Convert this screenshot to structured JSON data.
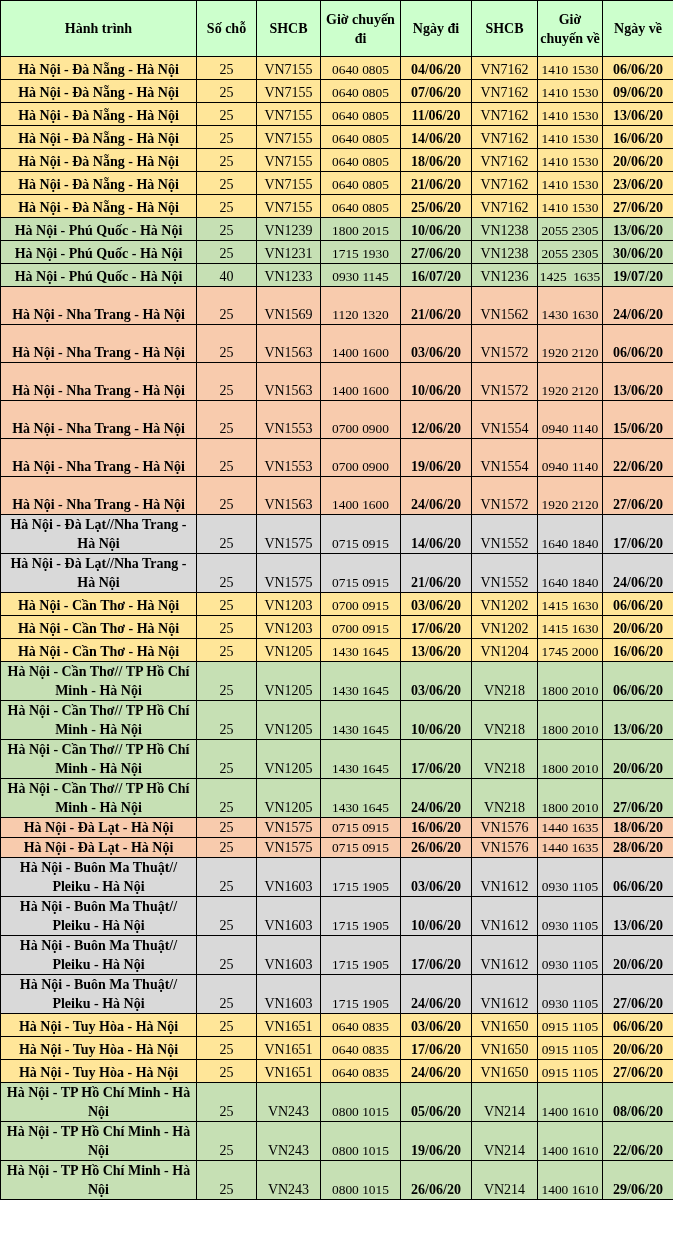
{
  "table": {
    "columns": [
      "Hành trình",
      "Số chỗ",
      "SHCB",
      "Giờ chuyến đi",
      "Ngày đi",
      "SHCB",
      "Giờ chuyến về",
      "Ngày về"
    ],
    "rows": [
      {
        "color": "#ffe699",
        "cells": [
          "Hà Nội - Đà Nẵng - Hà Nội",
          "25",
          "VN7155",
          "0640 0805",
          "04/06/20",
          "VN7162",
          "1410 1530",
          "06/06/20"
        ]
      },
      {
        "color": "#ffe699",
        "cells": [
          "Hà Nội - Đà Nẵng - Hà Nội",
          "25",
          "VN7155",
          "0640 0805",
          "07/06/20",
          "VN7162",
          "1410 1530",
          "09/06/20"
        ]
      },
      {
        "color": "#ffe699",
        "cells": [
          "Hà Nội - Đà Nẵng - Hà Nội",
          "25",
          "VN7155",
          "0640 0805",
          "11/06/20",
          "VN7162",
          "1410 1530",
          "13/06/20"
        ]
      },
      {
        "color": "#ffe699",
        "cells": [
          "Hà Nội - Đà Nẵng - Hà Nội",
          "25",
          "VN7155",
          "0640 0805",
          "14/06/20",
          "VN7162",
          "1410 1530",
          "16/06/20"
        ]
      },
      {
        "color": "#ffe699",
        "cells": [
          "Hà Nội - Đà Nẵng - Hà Nội",
          "25",
          "VN7155",
          "0640 0805",
          "18/06/20",
          "VN7162",
          "1410 1530",
          "20/06/20"
        ]
      },
      {
        "color": "#ffe699",
        "cells": [
          "Hà Nội - Đà Nẵng - Hà Nội",
          "25",
          "VN7155",
          "0640 0805",
          "21/06/20",
          "VN7162",
          "1410 1530",
          "23/06/20"
        ]
      },
      {
        "color": "#ffe699",
        "cells": [
          "Hà Nội - Đà Nẵng - Hà Nội",
          "25",
          "VN7155",
          "0640 0805",
          "25/06/20",
          "VN7162",
          "1410 1530",
          "27/06/20"
        ]
      },
      {
        "color": "#c6e0b4",
        "cells": [
          "Hà Nội - Phú Quốc - Hà Nội",
          "25",
          "VN1239",
          "1800 2015",
          "10/06/20",
          "VN1238",
          "2055 2305",
          "13/06/20"
        ]
      },
      {
        "color": "#c6e0b4",
        "cells": [
          "Hà Nội - Phú Quốc - Hà Nội",
          "25",
          "VN1231",
          "1715 1930",
          "27/06/20",
          "VN1238",
          "2055 2305",
          "30/06/20"
        ]
      },
      {
        "color": "#c6e0b4",
        "cells": [
          "Hà Nội - Phú Quốc - Hà Nội",
          "40",
          "VN1233",
          "0930 1145",
          "16/07/20",
          "VN1236",
          "1425  1635",
          "19/07/20"
        ]
      },
      {
        "color": "#f8cbad",
        "cells": [
          "Hà Nội - Nha Trang - Hà Nội",
          "25",
          "VN1569",
          "1120 1320",
          "21/06/20",
          "VN1562",
          "1430 1630",
          "24/06/20"
        ]
      },
      {
        "color": "#f8cbad",
        "cells": [
          "Hà Nội - Nha Trang - Hà Nội",
          "25",
          "VN1563",
          "1400 1600",
          "03/06/20",
          "VN1572",
          "1920 2120",
          "06/06/20"
        ]
      },
      {
        "color": "#f8cbad",
        "cells": [
          "Hà Nội - Nha Trang - Hà Nội",
          "25",
          "VN1563",
          "1400 1600",
          "10/06/20",
          "VN1572",
          "1920 2120",
          "13/06/20"
        ]
      },
      {
        "color": "#f8cbad",
        "cells": [
          "Hà Nội - Nha Trang - Hà Nội",
          "25",
          "VN1553",
          "0700 0900",
          "12/06/20",
          "VN1554",
          "0940 1140",
          "15/06/20"
        ]
      },
      {
        "color": "#f8cbad",
        "cells": [
          "Hà Nội - Nha Trang - Hà Nội",
          "25",
          "VN1553",
          "0700 0900",
          "19/06/20",
          "VN1554",
          "0940 1140",
          "22/06/20"
        ]
      },
      {
        "color": "#f8cbad",
        "cells": [
          "Hà Nội - Nha Trang - Hà Nội",
          "25",
          "VN1563",
          "1400 1600",
          "24/06/20",
          "VN1572",
          "1920 2120",
          "27/06/20"
        ]
      },
      {
        "color": "#d9d9d9",
        "cells": [
          "Hà Nội - Đà Lạt//Nha Trang - Hà Nội",
          "25",
          "VN1575",
          "0715 0915",
          "14/06/20",
          "VN1552",
          "1640 1840",
          "17/06/20"
        ]
      },
      {
        "color": "#d9d9d9",
        "cells": [
          "Hà Nội - Đà Lạt//Nha Trang - Hà Nội",
          "25",
          "VN1575",
          "0715 0915",
          "21/06/20",
          "VN1552",
          "1640 1840",
          "24/06/20"
        ]
      },
      {
        "color": "#ffe699",
        "cells": [
          "Hà Nội - Cần Thơ - Hà Nội",
          "25",
          "VN1203",
          "0700 0915",
          "03/06/20",
          "VN1202",
          "1415 1630",
          "06/06/20"
        ]
      },
      {
        "color": "#ffe699",
        "cells": [
          "Hà Nội - Cần Thơ - Hà Nội",
          "25",
          "VN1203",
          "0700 0915",
          "17/06/20",
          "VN1202",
          "1415 1630",
          "20/06/20"
        ]
      },
      {
        "color": "#ffe699",
        "cells": [
          "Hà Nội - Cần Thơ - Hà Nội",
          "25",
          "VN1205",
          "1430 1645",
          "13/06/20",
          "VN1204",
          "1745 2000",
          "16/06/20"
        ]
      },
      {
        "color": "#c6e0b4",
        "cells": [
          "Hà Nội - Cần Thơ// TP Hồ Chí Minh - Hà Nội",
          "25",
          "VN1205",
          "1430 1645",
          "03/06/20",
          "VN218",
          "1800 2010",
          "06/06/20"
        ]
      },
      {
        "color": "#c6e0b4",
        "cells": [
          "Hà Nội - Cần Thơ// TP Hồ Chí Minh - Hà Nội",
          "25",
          "VN1205",
          "1430 1645",
          "10/06/20",
          "VN218",
          "1800 2010",
          "13/06/20"
        ]
      },
      {
        "color": "#c6e0b4",
        "cells": [
          "Hà Nội - Cần Thơ// TP Hồ Chí Minh - Hà Nội",
          "25",
          "VN1205",
          "1430 1645",
          "17/06/20",
          "VN218",
          "1800 2010",
          "20/06/20"
        ]
      },
      {
        "color": "#c6e0b4",
        "cells": [
          "Hà Nội - Cần Thơ// TP Hồ Chí Minh - Hà Nội",
          "25",
          "VN1205",
          "1430 1645",
          "24/06/20",
          "VN218",
          "1800 2010",
          "27/06/20"
        ]
      },
      {
        "color": "#f8cbad",
        "cells": [
          "Hà Nội - Đà Lạt - Hà Nội",
          "25",
          "VN1575",
          "0715 0915",
          "16/06/20",
          "VN1576",
          "1440 1635",
          "18/06/20"
        ]
      },
      {
        "color": "#f8cbad",
        "cells": [
          "Hà Nội - Đà Lạt - Hà Nội",
          "25",
          "VN1575",
          "0715 0915",
          "26/06/20",
          "VN1576",
          "1440 1635",
          "28/06/20"
        ]
      },
      {
        "color": "#d9d9d9",
        "cells": [
          "Hà Nội - Buôn Ma Thuật// Pleiku - Hà Nội",
          "25",
          "VN1603",
          "1715 1905",
          "03/06/20",
          "VN1612",
          "0930 1105",
          "06/06/20"
        ]
      },
      {
        "color": "#d9d9d9",
        "cells": [
          "Hà Nội - Buôn Ma Thuật// Pleiku - Hà Nội",
          "25",
          "VN1603",
          "1715 1905",
          "10/06/20",
          "VN1612",
          "0930 1105",
          "13/06/20"
        ]
      },
      {
        "color": "#d9d9d9",
        "cells": [
          "Hà Nội - Buôn Ma Thuật// Pleiku - Hà Nội",
          "25",
          "VN1603",
          "1715 1905",
          "17/06/20",
          "VN1612",
          "0930 1105",
          "20/06/20"
        ]
      },
      {
        "color": "#d9d9d9",
        "cells": [
          "Hà Nội - Buôn Ma Thuật// Pleiku - Hà Nội",
          "25",
          "VN1603",
          "1715 1905",
          "24/06/20",
          "VN1612",
          "0930 1105",
          "27/06/20"
        ]
      },
      {
        "color": "#ffe699",
        "cells": [
          "Hà Nội - Tuy Hòa - Hà Nội",
          "25",
          "VN1651",
          "0640 0835",
          "03/06/20",
          "VN1650",
          "0915 1105",
          "06/06/20"
        ]
      },
      {
        "color": "#ffe699",
        "cells": [
          "Hà Nội - Tuy Hòa - Hà Nội",
          "25",
          "VN1651",
          "0640 0835",
          "17/06/20",
          "VN1650",
          "0915 1105",
          "20/06/20"
        ]
      },
      {
        "color": "#ffe699",
        "cells": [
          "Hà Nội - Tuy Hòa - Hà Nội",
          "25",
          "VN1651",
          "0640 0835",
          "24/06/20",
          "VN1650",
          "0915 1105",
          "27/06/20"
        ]
      },
      {
        "color": "#c6e0b4",
        "cells": [
          "Hà Nội - TP Hồ Chí Minh - Hà Nội",
          "25",
          "VN243",
          "0800 1015",
          "05/06/20",
          "VN214",
          "1400 1610",
          "08/06/20"
        ]
      },
      {
        "color": "#c6e0b4",
        "cells": [
          "Hà Nội - TP Hồ Chí Minh - Hà Nội",
          "25",
          "VN243",
          "0800 1015",
          "19/06/20",
          "VN214",
          "1400 1610",
          "22/06/20"
        ]
      },
      {
        "color": "#c6e0b4",
        "cells": [
          "Hà Nội - TP Hồ Chí Minh - Hà Nội",
          "25",
          "VN243",
          "0800 1015",
          "26/06/20",
          "VN214",
          "1400 1610",
          "29/06/20"
        ]
      }
    ]
  }
}
